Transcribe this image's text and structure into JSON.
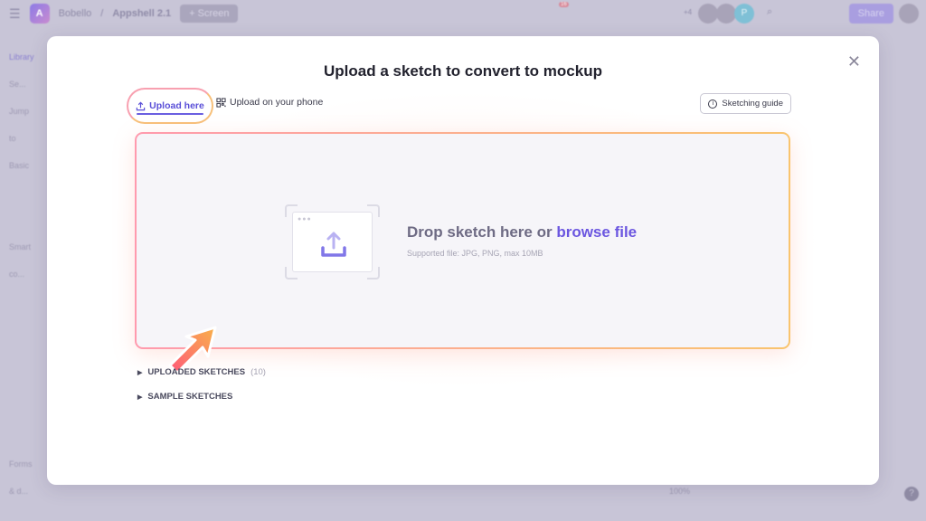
{
  "app": {
    "logo_letter": "A",
    "breadcrumb": [
      "Bobello",
      "Appshell 2.1"
    ],
    "add_screen_label": "+ Screen",
    "notification_count": "16",
    "collaborators_extra": "+4",
    "collaborator_initial": "P",
    "share_label": "Share",
    "sidebar": {
      "tab": "Library",
      "search_placeholder": "Se...",
      "jump_to": "Jump to",
      "sections": [
        "Basic",
        "Smart co...",
        "Forms & d..."
      ]
    },
    "zoom_level": "100%",
    "help_label": "?"
  },
  "modal": {
    "title": "Upload a sketch to convert to mockup",
    "tabs": [
      {
        "label": "Upload here",
        "icon": "upload-icon",
        "active": true
      },
      {
        "label": "Upload on your phone",
        "icon": "qr-code-icon",
        "active": false
      }
    ],
    "guide_label": "Sketching guide",
    "dropzone": {
      "prefix": "Drop sketch here or ",
      "link": "browse file",
      "supported": "Supported file: JPG, PNG, max 10MB"
    },
    "sections": [
      {
        "label": "UPLOADED SKETCHES",
        "count": "(10)"
      },
      {
        "label": "SAMPLE SKETCHES"
      }
    ],
    "colors": {
      "accent": "#6b56e0",
      "gradient_start": "#ff9aae",
      "gradient_end": "#f9c46e"
    }
  }
}
